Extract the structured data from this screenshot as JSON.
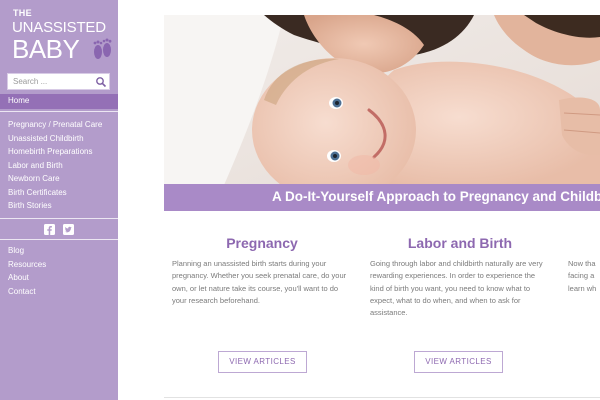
{
  "brand": {
    "line1": "THE",
    "line2": "UNASSISTED",
    "line3": "BABY",
    "logo_icon": "baby-feet-icon",
    "color": "#b39ccb",
    "accent": "#8d68b0"
  },
  "search": {
    "placeholder": "Search ...",
    "icon": "search-icon"
  },
  "nav": {
    "home": "Home",
    "primary": [
      "Pregnancy / Prenatal Care",
      "Unassisted Childbirth",
      "Homebirth Preparations",
      "Labor and Birth",
      "Newborn Care",
      "Birth Certificates",
      "Birth Stories"
    ],
    "social": [
      "facebook-icon",
      "twitter-icon"
    ],
    "secondary": [
      "Blog",
      "Resources",
      "About",
      "Contact"
    ]
  },
  "hero": {
    "image": "parent-kissing-smiling-baby",
    "banner": "A Do-It-Yourself Approach to Pregnancy and Childbirth"
  },
  "columns": [
    {
      "title": "Pregnancy",
      "text": "Planning an unassisted birth starts during your pregnancy. Whether you seek prenatal care, do your own, or let nature take its course, you'll want to do your research beforehand.",
      "button": "VIEW ARTICLES"
    },
    {
      "title": "Labor and Birth",
      "text": "Going through labor and childbirth naturally are very rewarding experiences. In order to experience the kind of birth you want, you need to know what to expect, what to do when, and when to ask for assistance.",
      "button": "VIEW ARTICLES"
    }
  ],
  "column3_partial": [
    "Now tha",
    "facing a",
    "learn wh"
  ]
}
